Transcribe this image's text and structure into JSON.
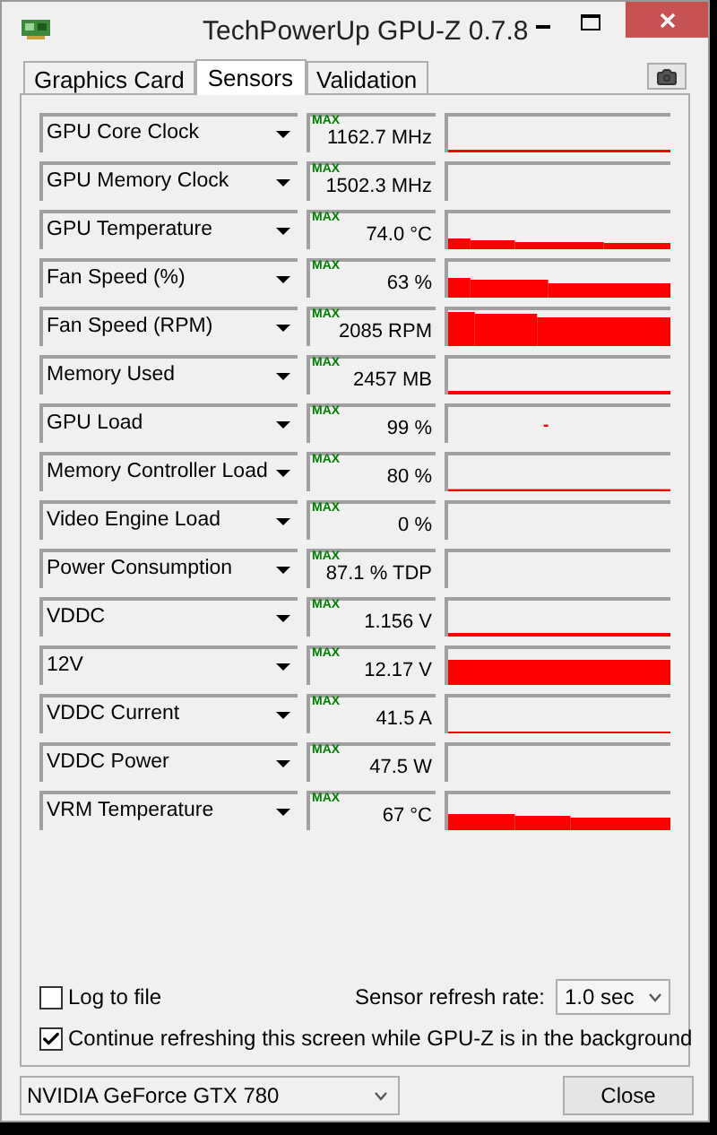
{
  "window": {
    "title": "TechPowerUp GPU-Z 0.7.8"
  },
  "tabs": [
    {
      "label": "Graphics Card",
      "selected": false
    },
    {
      "label": "Sensors",
      "selected": true
    },
    {
      "label": "Validation",
      "selected": false
    }
  ],
  "sensors": [
    {
      "name": "GPU Core Clock",
      "max_label": "MAX",
      "value": "1162.7 MHz"
    },
    {
      "name": "GPU Memory Clock",
      "max_label": "MAX",
      "value": "1502.3 MHz"
    },
    {
      "name": "GPU Temperature",
      "max_label": "MAX",
      "value": "74.0 °C"
    },
    {
      "name": "Fan Speed (%)",
      "max_label": "MAX",
      "value": "63 %"
    },
    {
      "name": "Fan Speed (RPM)",
      "max_label": "MAX",
      "value": "2085 RPM"
    },
    {
      "name": "Memory Used",
      "max_label": "MAX",
      "value": "2457 MB"
    },
    {
      "name": "GPU Load",
      "max_label": "MAX",
      "value": "99 %"
    },
    {
      "name": "Memory Controller Load",
      "max_label": "MAX",
      "value": "80 %"
    },
    {
      "name": "Video Engine Load",
      "max_label": "MAX",
      "value": "0 %"
    },
    {
      "name": "Power Consumption",
      "max_label": "MAX",
      "value": "87.1 % TDP"
    },
    {
      "name": "VDDC",
      "max_label": "MAX",
      "value": "1.156 V"
    },
    {
      "name": "12V",
      "max_label": "MAX",
      "value": "12.17 V"
    },
    {
      "name": "VDDC Current",
      "max_label": "MAX",
      "value": "41.5 A"
    },
    {
      "name": "VDDC Power",
      "max_label": "MAX",
      "value": "47.5 W"
    },
    {
      "name": "VRM Temperature",
      "max_label": "MAX",
      "value": "67 °C"
    }
  ],
  "log_to_file": {
    "label": "Log to file",
    "checked": false
  },
  "refresh_rate": {
    "label": "Sensor refresh rate:",
    "value": "1.0 sec"
  },
  "background_refresh": {
    "label": "Continue refreshing this screen while GPU-Z is in the background",
    "checked": true
  },
  "gpu_select": {
    "value": "NVIDIA GeForce GTX 780"
  },
  "close_button": {
    "label": "Close"
  }
}
